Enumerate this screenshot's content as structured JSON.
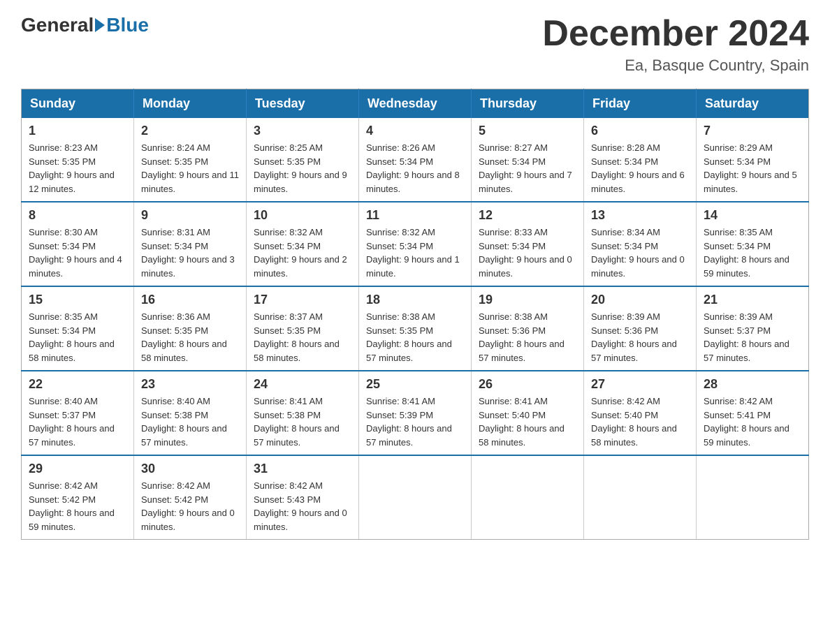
{
  "header": {
    "logo_general": "General",
    "logo_blue": "Blue",
    "month_title": "December 2024",
    "location": "Ea, Basque Country, Spain"
  },
  "calendar": {
    "days_of_week": [
      "Sunday",
      "Monday",
      "Tuesday",
      "Wednesday",
      "Thursday",
      "Friday",
      "Saturday"
    ],
    "weeks": [
      [
        {
          "day": "1",
          "sunrise": "8:23 AM",
          "sunset": "5:35 PM",
          "daylight": "9 hours and 12 minutes."
        },
        {
          "day": "2",
          "sunrise": "8:24 AM",
          "sunset": "5:35 PM",
          "daylight": "9 hours and 11 minutes."
        },
        {
          "day": "3",
          "sunrise": "8:25 AM",
          "sunset": "5:35 PM",
          "daylight": "9 hours and 9 minutes."
        },
        {
          "day": "4",
          "sunrise": "8:26 AM",
          "sunset": "5:34 PM",
          "daylight": "9 hours and 8 minutes."
        },
        {
          "day": "5",
          "sunrise": "8:27 AM",
          "sunset": "5:34 PM",
          "daylight": "9 hours and 7 minutes."
        },
        {
          "day": "6",
          "sunrise": "8:28 AM",
          "sunset": "5:34 PM",
          "daylight": "9 hours and 6 minutes."
        },
        {
          "day": "7",
          "sunrise": "8:29 AM",
          "sunset": "5:34 PM",
          "daylight": "9 hours and 5 minutes."
        }
      ],
      [
        {
          "day": "8",
          "sunrise": "8:30 AM",
          "sunset": "5:34 PM",
          "daylight": "9 hours and 4 minutes."
        },
        {
          "day": "9",
          "sunrise": "8:31 AM",
          "sunset": "5:34 PM",
          "daylight": "9 hours and 3 minutes."
        },
        {
          "day": "10",
          "sunrise": "8:32 AM",
          "sunset": "5:34 PM",
          "daylight": "9 hours and 2 minutes."
        },
        {
          "day": "11",
          "sunrise": "8:32 AM",
          "sunset": "5:34 PM",
          "daylight": "9 hours and 1 minute."
        },
        {
          "day": "12",
          "sunrise": "8:33 AM",
          "sunset": "5:34 PM",
          "daylight": "9 hours and 0 minutes."
        },
        {
          "day": "13",
          "sunrise": "8:34 AM",
          "sunset": "5:34 PM",
          "daylight": "9 hours and 0 minutes."
        },
        {
          "day": "14",
          "sunrise": "8:35 AM",
          "sunset": "5:34 PM",
          "daylight": "8 hours and 59 minutes."
        }
      ],
      [
        {
          "day": "15",
          "sunrise": "8:35 AM",
          "sunset": "5:34 PM",
          "daylight": "8 hours and 58 minutes."
        },
        {
          "day": "16",
          "sunrise": "8:36 AM",
          "sunset": "5:35 PM",
          "daylight": "8 hours and 58 minutes."
        },
        {
          "day": "17",
          "sunrise": "8:37 AM",
          "sunset": "5:35 PM",
          "daylight": "8 hours and 58 minutes."
        },
        {
          "day": "18",
          "sunrise": "8:38 AM",
          "sunset": "5:35 PM",
          "daylight": "8 hours and 57 minutes."
        },
        {
          "day": "19",
          "sunrise": "8:38 AM",
          "sunset": "5:36 PM",
          "daylight": "8 hours and 57 minutes."
        },
        {
          "day": "20",
          "sunrise": "8:39 AM",
          "sunset": "5:36 PM",
          "daylight": "8 hours and 57 minutes."
        },
        {
          "day": "21",
          "sunrise": "8:39 AM",
          "sunset": "5:37 PM",
          "daylight": "8 hours and 57 minutes."
        }
      ],
      [
        {
          "day": "22",
          "sunrise": "8:40 AM",
          "sunset": "5:37 PM",
          "daylight": "8 hours and 57 minutes."
        },
        {
          "day": "23",
          "sunrise": "8:40 AM",
          "sunset": "5:38 PM",
          "daylight": "8 hours and 57 minutes."
        },
        {
          "day": "24",
          "sunrise": "8:41 AM",
          "sunset": "5:38 PM",
          "daylight": "8 hours and 57 minutes."
        },
        {
          "day": "25",
          "sunrise": "8:41 AM",
          "sunset": "5:39 PM",
          "daylight": "8 hours and 57 minutes."
        },
        {
          "day": "26",
          "sunrise": "8:41 AM",
          "sunset": "5:40 PM",
          "daylight": "8 hours and 58 minutes."
        },
        {
          "day": "27",
          "sunrise": "8:42 AM",
          "sunset": "5:40 PM",
          "daylight": "8 hours and 58 minutes."
        },
        {
          "day": "28",
          "sunrise": "8:42 AM",
          "sunset": "5:41 PM",
          "daylight": "8 hours and 59 minutes."
        }
      ],
      [
        {
          "day": "29",
          "sunrise": "8:42 AM",
          "sunset": "5:42 PM",
          "daylight": "8 hours and 59 minutes."
        },
        {
          "day": "30",
          "sunrise": "8:42 AM",
          "sunset": "5:42 PM",
          "daylight": "9 hours and 0 minutes."
        },
        {
          "day": "31",
          "sunrise": "8:42 AM",
          "sunset": "5:43 PM",
          "daylight": "9 hours and 0 minutes."
        },
        null,
        null,
        null,
        null
      ]
    ],
    "labels": {
      "sunrise": "Sunrise:",
      "sunset": "Sunset:",
      "daylight": "Daylight:"
    }
  }
}
